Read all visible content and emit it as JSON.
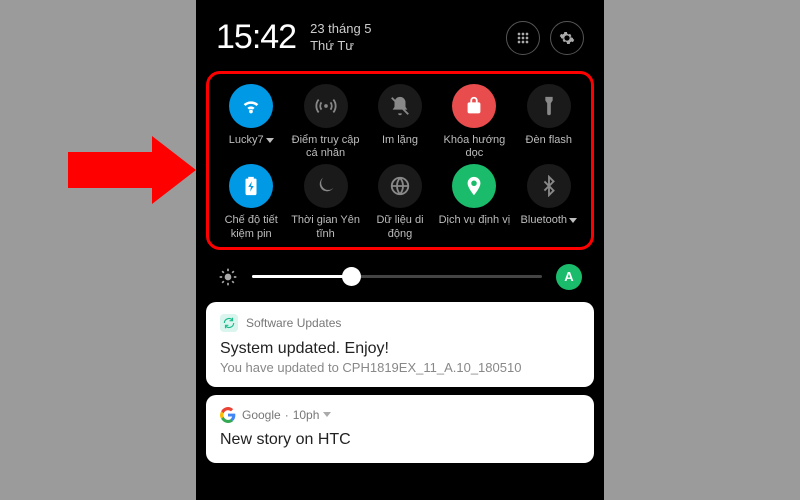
{
  "header": {
    "time": "15:42",
    "date_line1": "23 tháng 5",
    "date_line2": "Thứ Tư"
  },
  "tiles": {
    "t0": "Lucky7",
    "t1": "Điểm truy cập cá nhân",
    "t2": "Im lặng",
    "t3": "Khóa hướng dọc",
    "t4": "Đèn flash",
    "t5": "Chế độ tiết kiệm pin",
    "t6": "Thời gian Yên tĩnh",
    "t7": "Dữ liệu di động",
    "t8": "Dịch vụ định vị",
    "t9": "Bluetooth"
  },
  "brightness": {
    "auto": "A",
    "percent": 34
  },
  "notif1": {
    "app": "Software Updates",
    "title": "System updated. Enjoy!",
    "body": "You have updated to CPH1819EX_11_A.10_180510"
  },
  "notif2": {
    "app": "Google",
    "time": "10ph",
    "title": "New story on HTC"
  }
}
